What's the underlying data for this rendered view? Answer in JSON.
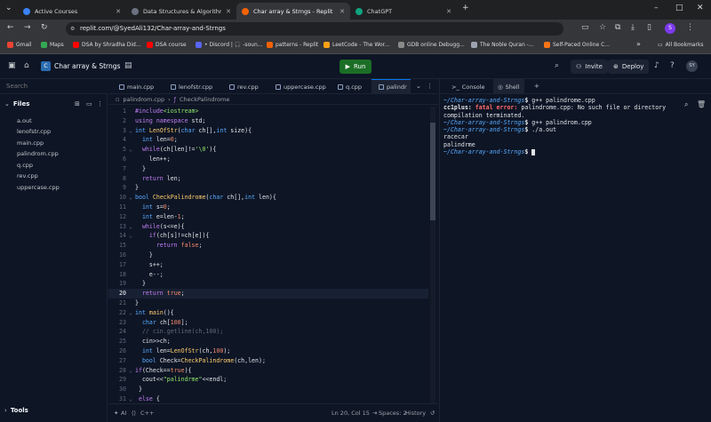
{
  "browser": {
    "tabs": [
      {
        "title": "Active Courses",
        "icon": "coursera-icon",
        "color": "#3b82f6",
        "active": false
      },
      {
        "title": "Data Structures & Algorithms i...",
        "icon": "course-icon",
        "color": "#6b7280",
        "active": false
      },
      {
        "title": "Char array & Strngs - Replit",
        "icon": "replit-icon",
        "color": "#f26207",
        "active": true
      },
      {
        "title": "ChatGPT",
        "icon": "chatgpt-icon",
        "color": "#10a37f",
        "active": false
      }
    ],
    "new_tab": "+",
    "window_controls": {
      "minimize": "–",
      "maximize": "□",
      "close": "✕"
    },
    "url": "replit.com/@SyedAli132/Char-array-and-Strngs",
    "bookmarks": [
      {
        "label": "Gmail",
        "color": "#ea4335"
      },
      {
        "label": "Maps",
        "color": "#34a853"
      },
      {
        "label": "DSA by Shradha Did...",
        "color": "#ff0000"
      },
      {
        "label": "DSA course",
        "color": "#ff0000"
      },
      {
        "label": "• Discord | 🎧 -soun...",
        "color": "#5865f2"
      },
      {
        "label": "patterns - Replit",
        "color": "#f26207"
      },
      {
        "label": "LeetCode - The Wor...",
        "color": "#ffa116"
      },
      {
        "label": "GDB online Debugg...",
        "color": "#8a8a8a"
      },
      {
        "label": "The Noble Quran -...",
        "color": "#9ca3af"
      },
      {
        "label": "Self-Paced Online C...",
        "color": "#f97316"
      }
    ],
    "bookmarks_more": "»",
    "all_bookmarks": "All Bookmarks"
  },
  "replit": {
    "repl_name": "Char array & Strngs",
    "run_label": "Run",
    "invite_label": "Invite",
    "deploy_label": "Deploy",
    "avatar_text": "SY"
  },
  "sidebar": {
    "search_placeholder": "Search",
    "files_label": "Files",
    "files": [
      "a.out",
      "lenofstr.cpp",
      "main.cpp",
      "palindrom.cpp",
      "q.cpp",
      "rev.cpp",
      "uppercase.cpp"
    ],
    "tools_label": "Tools"
  },
  "editor": {
    "tabs": [
      "main.cpp",
      "lenofstr.cpp",
      "rev.cpp",
      "uppercase.cpp",
      "q.cpp",
      "palindr"
    ],
    "breadcrumb_file": "palindrom.cpp",
    "breadcrumb_func": "CheckPalindrome",
    "current_line": 20,
    "status": {
      "ai": "AI",
      "lang": "C++",
      "position": "Ln 20, Col 15",
      "spaces": "Spaces: 2",
      "history": "History"
    }
  },
  "console": {
    "tabs": [
      "Console",
      "Shell"
    ],
    "active_tab": "Shell"
  }
}
